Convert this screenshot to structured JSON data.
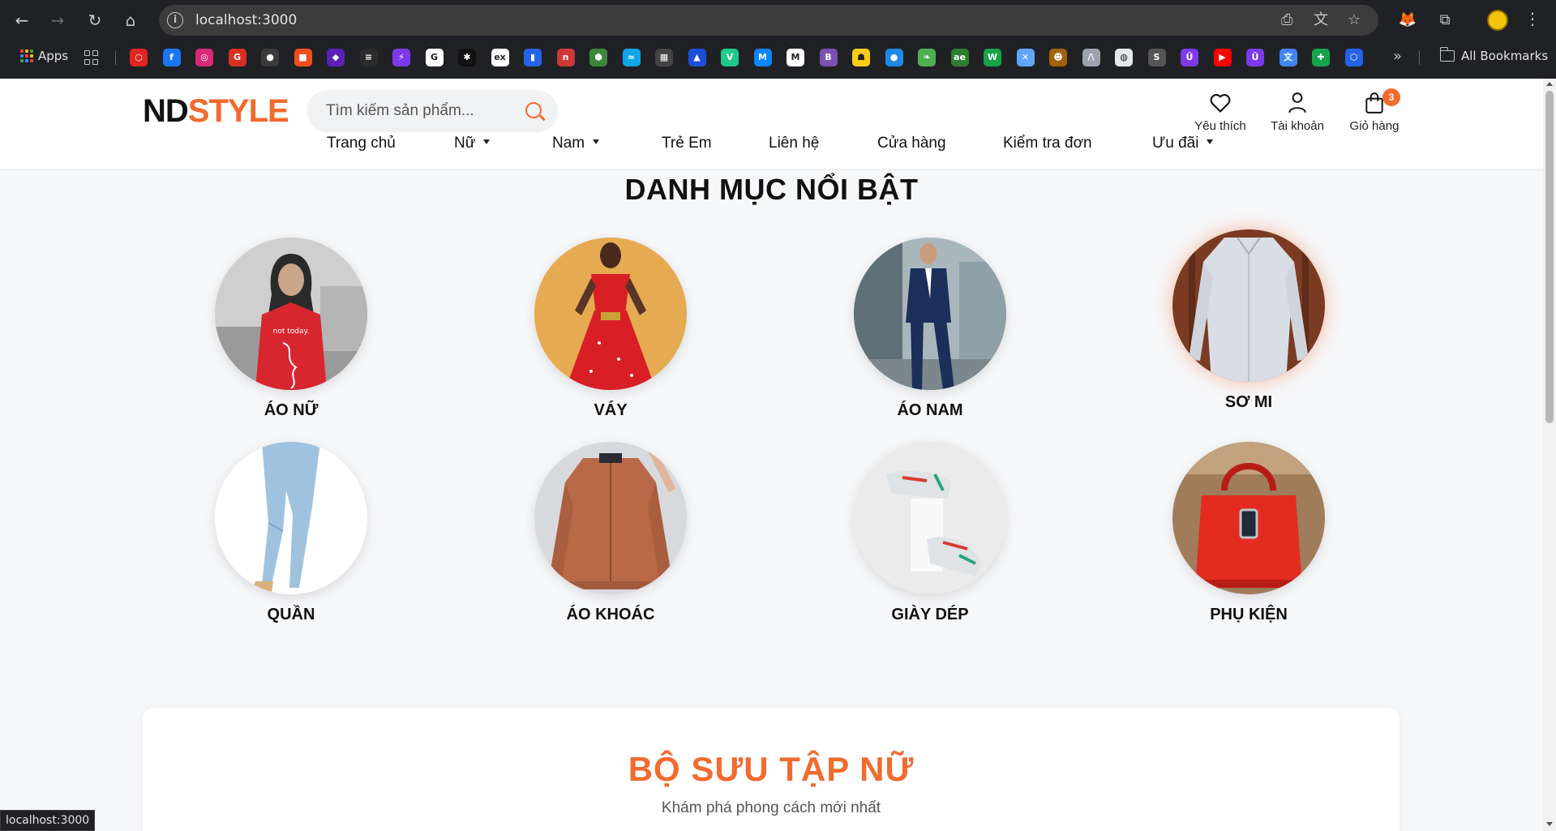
{
  "browser": {
    "url": "localhost:3000",
    "bookmarks_apps_label": "Apps",
    "all_bookmarks_label": "All Bookmarks",
    "status_url": "localhost:3000",
    "favicons": [
      {
        "name": "bookmark-red-app",
        "color": "#e02424",
        "glyph": "○"
      },
      {
        "name": "bookmark-facebook",
        "color": "#1877f2",
        "glyph": "f"
      },
      {
        "name": "bookmark-instagram",
        "color": "#d62976",
        "glyph": "◎"
      },
      {
        "name": "bookmark-app-red",
        "color": "#d93025",
        "glyph": "G"
      },
      {
        "name": "bookmark-github",
        "color": "#3a3a3a",
        "glyph": "●"
      },
      {
        "name": "bookmark-figma",
        "color": "#f24e1e",
        "glyph": "■"
      },
      {
        "name": "bookmark-purple-app",
        "color": "#5b21b6",
        "glyph": "◆"
      },
      {
        "name": "bookmark-stack",
        "color": "#2b2b2b",
        "glyph": "≡"
      },
      {
        "name": "bookmark-bolt",
        "color": "#7c3aed",
        "glyph": "⚡"
      },
      {
        "name": "bookmark-google",
        "color": "#ffffff",
        "glyph": "G"
      },
      {
        "name": "bookmark-spark",
        "color": "#111111",
        "glyph": "✱"
      },
      {
        "name": "bookmark-ex",
        "color": "#ffffff",
        "glyph": "ex"
      },
      {
        "name": "bookmark-app-blue",
        "color": "#2563eb",
        "glyph": "▮"
      },
      {
        "name": "bookmark-npm",
        "color": "#cb3837",
        "glyph": "n"
      },
      {
        "name": "bookmark-node",
        "color": "#3c873a",
        "glyph": "⬢"
      },
      {
        "name": "bookmark-wave",
        "color": "#0ea5e9",
        "glyph": "≈"
      },
      {
        "name": "bookmark-stripe",
        "color": "#444444",
        "glyph": "▦"
      },
      {
        "name": "bookmark-triangle",
        "color": "#1d4ed8",
        "glyph": "▲"
      },
      {
        "name": "bookmark-vuetify",
        "color": "#1ec98b",
        "glyph": "V"
      },
      {
        "name": "bookmark-mui",
        "color": "#0a84ff",
        "glyph": "M"
      },
      {
        "name": "bookmark-m",
        "color": "#ffffff",
        "glyph": "M"
      },
      {
        "name": "bookmark-bootstrap",
        "color": "#7952b3",
        "glyph": "B"
      },
      {
        "name": "bookmark-mask",
        "color": "#facc15",
        "glyph": "☗"
      },
      {
        "name": "bookmark-drop",
        "color": "#1e88e5",
        "glyph": "●"
      },
      {
        "name": "bookmark-leaf",
        "color": "#4caf50",
        "glyph": "❧"
      },
      {
        "name": "bookmark-ae",
        "color": "#2e7d32",
        "glyph": "ae"
      },
      {
        "name": "bookmark-w",
        "color": "#16a34a",
        "glyph": "W"
      },
      {
        "name": "bookmark-x",
        "color": "#60a5fa",
        "glyph": "✕"
      },
      {
        "name": "bookmark-monkey",
        "color": "#a16207",
        "glyph": "☻"
      },
      {
        "name": "bookmark-n",
        "color": "#9ca3af",
        "glyph": "/\\"
      },
      {
        "name": "bookmark-globe",
        "color": "#e5e7eb",
        "glyph": "◍"
      },
      {
        "name": "bookmark-s",
        "color": "#555555",
        "glyph": "S"
      },
      {
        "name": "bookmark-u1",
        "color": "#7c3aed",
        "glyph": "Û"
      },
      {
        "name": "bookmark-youtube",
        "color": "#ff0000",
        "glyph": "▶"
      },
      {
        "name": "bookmark-u2",
        "color": "#7c3aed",
        "glyph": "Û"
      },
      {
        "name": "bookmark-translate",
        "color": "#4285f4",
        "glyph": "文"
      },
      {
        "name": "bookmark-plus",
        "color": "#16a34a",
        "glyph": "✚"
      },
      {
        "name": "bookmark-hex",
        "color": "#2563eb",
        "glyph": "⬡"
      }
    ]
  },
  "site": {
    "logo_part1": "ND",
    "logo_part2": "STYLE",
    "search_placeholder": "Tìm kiếm sản phẩm...",
    "wishlist_label": "Yêu thích",
    "account_label": "Tài khoản",
    "cart_label": "Giỏ hàng",
    "cart_count": "3",
    "nav": [
      {
        "label": "Trang chủ",
        "dropdown": false
      },
      {
        "label": "Nữ",
        "dropdown": true
      },
      {
        "label": "Nam",
        "dropdown": true
      },
      {
        "label": "Trẻ Em",
        "dropdown": false
      },
      {
        "label": "Liên hệ",
        "dropdown": false
      },
      {
        "label": "Cửa hàng",
        "dropdown": false
      },
      {
        "label": "Kiểm tra đơn",
        "dropdown": false
      },
      {
        "label": "Ưu đãi",
        "dropdown": true
      }
    ],
    "accent_color": "#f26a2e"
  },
  "categories_section": {
    "title": "DANH MỤC NỔI BẬT",
    "items": [
      {
        "label": "ÁO NỮ",
        "image": "woman-red-tshirt-photo"
      },
      {
        "label": "VÁY",
        "image": "woman-red-dress-photo"
      },
      {
        "label": "ÁO NAM",
        "image": "man-navy-suit-photo"
      },
      {
        "label": "SƠ MI",
        "image": "white-shirt-hanger-photo"
      },
      {
        "label": "QUẦN",
        "image": "light-blue-jeans-photo"
      },
      {
        "label": "ÁO KHOÁC",
        "image": "brown-bomber-jacket-photo"
      },
      {
        "label": "GIÀY DÉP",
        "image": "sneakers-pair-photo"
      },
      {
        "label": "PHỤ KIỆN",
        "image": "red-handbag-photo"
      }
    ]
  },
  "collection": {
    "title": "BỘ SƯU TẬP NỮ",
    "subtitle": "Khám phá phong cách mới nhất"
  }
}
